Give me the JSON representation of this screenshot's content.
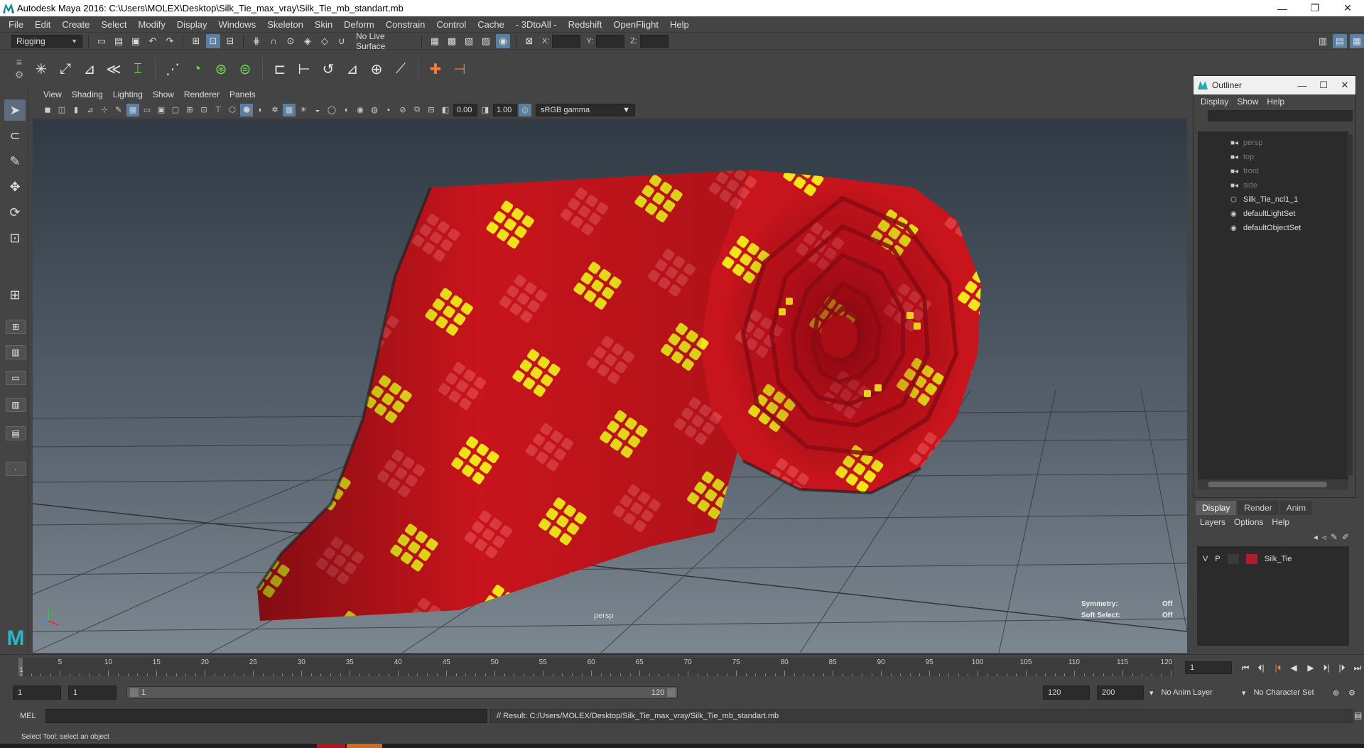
{
  "window": {
    "title": "Autodesk Maya 2016: C:\\Users\\MOLEX\\Desktop\\Silk_Tie_max_vray\\Silk_Tie_mb_standart.mb",
    "minimize": "—",
    "restore": "❐",
    "close": "✕"
  },
  "menubar": {
    "items": [
      "File",
      "Edit",
      "Create",
      "Select",
      "Modify",
      "Display",
      "Windows",
      "Skeleton",
      "Skin",
      "Deform",
      "Constrain",
      "Control",
      "Cache",
      "- 3DtoAll -",
      "Redshift",
      "OpenFlight",
      "Help"
    ]
  },
  "statusline": {
    "menuset": "Rigging",
    "live_surface": "No Live Surface",
    "x_label": "X:",
    "y_label": "Y:",
    "z_label": "Z:"
  },
  "viewport": {
    "menu": [
      "View",
      "Shading",
      "Lighting",
      "Show",
      "Renderer",
      "Panels"
    ],
    "exposure": "0.00",
    "gamma_value": "1.00",
    "color_space": "sRGB gamma",
    "camera": "persp",
    "hud": {
      "symmetry_label": "Symmetry:",
      "symmetry_value": "Off",
      "soft_select_label": "Soft Select:",
      "soft_select_value": "Off"
    }
  },
  "outliner": {
    "title": "Outliner",
    "menu": [
      "Display",
      "Show",
      "Help"
    ],
    "items": [
      {
        "label": "persp",
        "kind": "camera",
        "dim": true
      },
      {
        "label": "top",
        "kind": "camera",
        "dim": true
      },
      {
        "label": "front",
        "kind": "camera",
        "dim": true
      },
      {
        "label": "side",
        "kind": "camera",
        "dim": true
      },
      {
        "label": "Silk_Tie_ncl1_1",
        "kind": "mesh",
        "dim": false
      },
      {
        "label": "defaultLightSet",
        "kind": "set",
        "dim": false
      },
      {
        "label": "defaultObjectSet",
        "kind": "set",
        "dim": false
      }
    ]
  },
  "layer_editor": {
    "tabs": [
      "Display",
      "Render",
      "Anim"
    ],
    "active_tab": "Display",
    "menu": [
      "Layers",
      "Options",
      "Help"
    ],
    "layers": [
      {
        "v": "V",
        "p": "P",
        "name": "Silk_Tie",
        "color": "#b3192e"
      }
    ]
  },
  "timeline": {
    "ticks": [
      5,
      10,
      15,
      20,
      25,
      30,
      35,
      40,
      45,
      50,
      55,
      60,
      65,
      70,
      75,
      80,
      85,
      90,
      95,
      100,
      105,
      110,
      115,
      120
    ],
    "start": 1,
    "end": 120,
    "current_frame": "1",
    "first_label": "1"
  },
  "range": {
    "start_frame": "1",
    "playback_start": "1",
    "slider_start": "1",
    "slider_end": "120",
    "playback_end": "120",
    "end_frame": "200",
    "anim_layer": "No Anim Layer",
    "character_set": "No Character Set"
  },
  "command_line": {
    "language": "MEL",
    "result": "// Result: C:/Users/MOLEX/Desktop/Silk_Tie_max_vray/Silk_Tie_mb_standart.mb"
  },
  "help_line": {
    "text": "Select Tool: select an object"
  },
  "colors": {
    "tie_red": "#c8141c",
    "tie_yellow": "#f2e51a",
    "ui_bg": "#444444",
    "accent": "#5a7fa0"
  }
}
